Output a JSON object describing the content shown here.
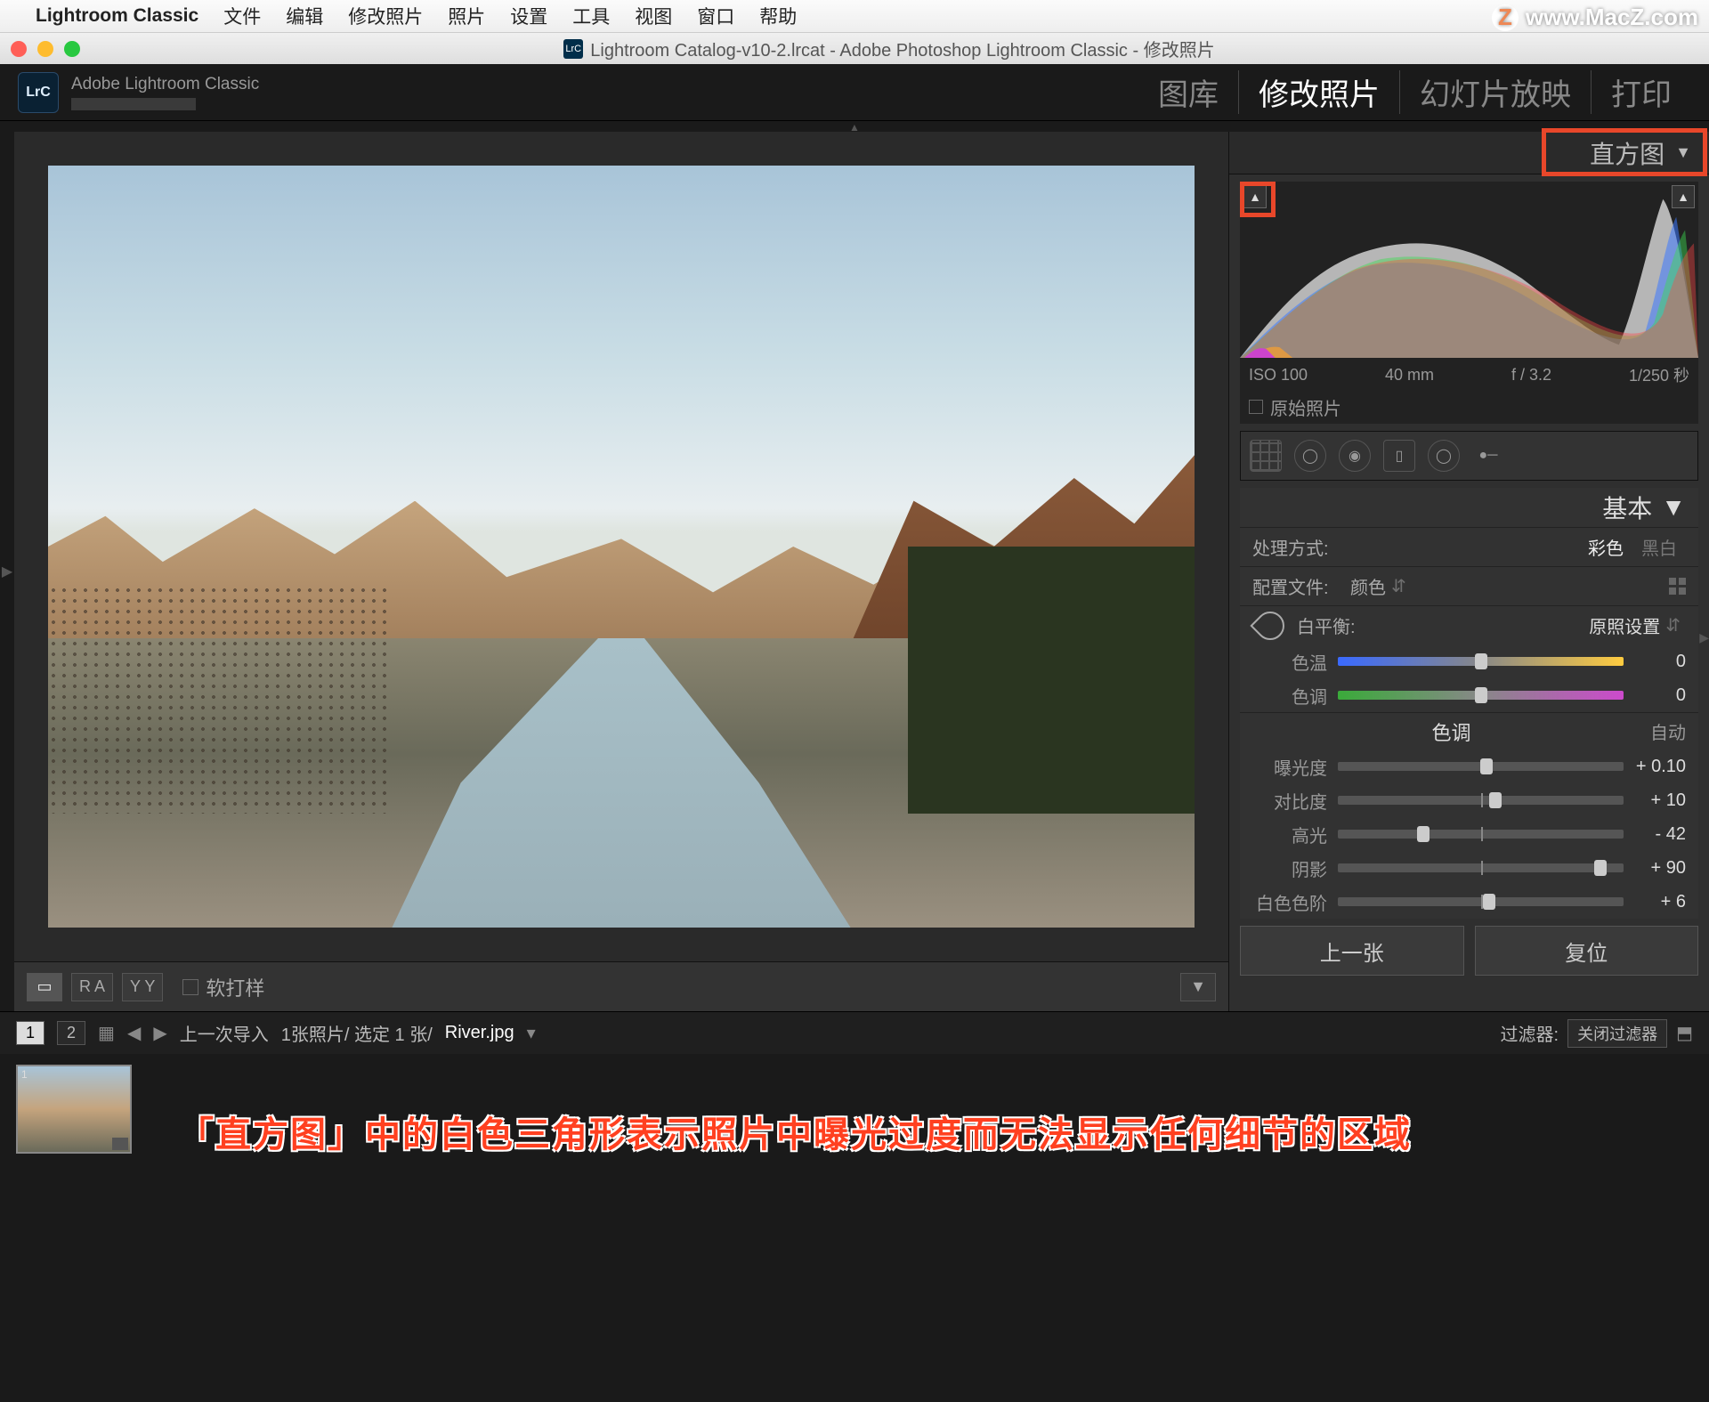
{
  "mac": {
    "app_name": "Lightroom Classic",
    "menus": [
      "文件",
      "编辑",
      "修改照片",
      "照片",
      "设置",
      "工具",
      "视图",
      "窗口",
      "帮助"
    ]
  },
  "watermark": {
    "z": "Z",
    "text": "www.MacZ.com"
  },
  "window": {
    "title": "Lightroom Catalog-v10-2.lrcat - Adobe Photoshop Lightroom Classic - 修改照片",
    "lrc_badge": "LrC"
  },
  "header": {
    "brand": "Adobe Lightroom Classic",
    "lrc": "LrC",
    "modules": [
      "图库",
      "修改照片",
      "幻灯片放映",
      "打印"
    ],
    "active_index": 1
  },
  "toolbar": {
    "softproof": "软打样",
    "disclosure": "▼"
  },
  "right": {
    "histogram": {
      "title": "直方图",
      "iso": "ISO 100",
      "focal": "40 mm",
      "aperture": "f / 3.2",
      "shutter": "1/250 秒",
      "original": "原始照片"
    },
    "nav": {
      "prev": "上一张",
      "reset": "复位"
    },
    "basic": {
      "title": "基本",
      "treatment_label": "处理方式:",
      "treatment_color": "彩色",
      "treatment_bw": "黑白",
      "profile_label": "配置文件:",
      "profile_value": "颜色",
      "wb_label": "白平衡:",
      "wb_value": "原照设置",
      "sliders": {
        "temp": {
          "label": "色温",
          "value": "0",
          "pos": 50
        },
        "tint": {
          "label": "色调",
          "value": "0",
          "pos": 50
        }
      },
      "tone_section": {
        "label": "色调",
        "auto": "自动"
      },
      "tone": {
        "exposure": {
          "label": "曝光度",
          "value": "+ 0.10",
          "pos": 52
        },
        "contrast": {
          "label": "对比度",
          "value": "+ 10",
          "pos": 55
        },
        "highlights": {
          "label": "高光",
          "value": "- 42",
          "pos": 30
        },
        "shadows": {
          "label": "阴影",
          "value": "+ 90",
          "pos": 92
        },
        "whites": {
          "label": "白色色阶",
          "value": "+ 6",
          "pos": 53
        }
      }
    }
  },
  "filmstrip": {
    "view1": "1",
    "view2": "2",
    "breadcrumb": "上一次导入",
    "count": "1张照片/ 选定 1 张/",
    "filename": "River.jpg",
    "filter_label": "过滤器:",
    "filter_value": "关闭过滤器"
  },
  "annotation": "「直方图」中的白色三角形表示照片中曝光过度而无法显示任何细节的区域"
}
